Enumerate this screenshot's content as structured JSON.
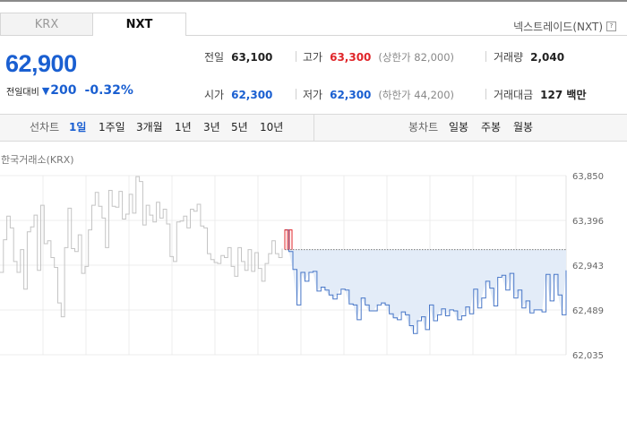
{
  "tabs": [
    {
      "label": "KRX",
      "active": false
    },
    {
      "label": "NXT",
      "active": true
    }
  ],
  "market_label": "넥스트레이드(NXT)",
  "help_icon": "?",
  "price": {
    "current": "62,900",
    "change_label": "전일대비",
    "change_direction": "down",
    "change_amount": "200",
    "change_percent": "-0.32%",
    "color": "#1a5fd1"
  },
  "summary": {
    "prev_close": {
      "label": "전일",
      "value": "63,100"
    },
    "high": {
      "label": "고가",
      "value": "63,300",
      "note": "(상한가 82,000)"
    },
    "volume": {
      "label": "거래량",
      "value": "2,040"
    },
    "open": {
      "label": "시가",
      "value": "62,300"
    },
    "low": {
      "label": "저가",
      "value": "62,300",
      "note": "(하한가 44,200)"
    },
    "trade_value": {
      "label": "거래대금",
      "value": "127 백만"
    }
  },
  "toolbar": {
    "line_label": "선차트",
    "periods": [
      "1일",
      "1주일",
      "3개월",
      "1년",
      "3년",
      "5년",
      "10년"
    ],
    "selected_period": "1일",
    "candle_label": "봉차트",
    "candle_periods": [
      "일봉",
      "주봉",
      "월봉"
    ]
  },
  "chart_data": {
    "type": "line",
    "source_label": "한국거래소(KRX)",
    "y_ticks": [
      "63,850",
      "63,396",
      "62,943",
      "62,489",
      "62,035"
    ],
    "ylim": [
      62035,
      63850
    ],
    "reference_price": 63100,
    "grid": true,
    "series": [
      {
        "color": "#c4c4c4",
        "values": [
          62870,
          63200,
          63440,
          63320,
          62980,
          62870,
          63100,
          62700,
          63280,
          63330,
          63450,
          62890,
          63550,
          63160,
          63190,
          63020,
          62920,
          62560,
          62420,
          63120,
          63520,
          63110,
          63080,
          63250,
          62860,
          62930,
          63300,
          63550,
          63680,
          63540,
          63420,
          63120,
          63700,
          63540,
          63530,
          63690,
          63410,
          63460,
          63660,
          63470,
          63840,
          63790,
          63350,
          63550,
          63450,
          63380,
          63580,
          63420,
          63510,
          63360,
          63030,
          62980,
          63380,
          63390,
          63440,
          63320,
          63510,
          63490,
          63560,
          63340,
          63320,
          63060,
          63000,
          62970,
          62960,
          63040,
          63020,
          63120,
          62930,
          62830,
          63120,
          62980,
          62890,
          63100,
          62880,
          63070,
          62910,
          62780,
          62960,
          63060,
          63190,
          63060,
          63020,
          63110
        ]
      },
      {
        "color": "#4a78c8",
        "values": [
          63300,
          63080,
          62900,
          62540,
          62870,
          62780,
          62870,
          62880,
          62680,
          62720,
          62690,
          62640,
          62600,
          62650,
          62700,
          62690,
          62550,
          62540,
          62390,
          62610,
          62540,
          62480,
          62480,
          62540,
          62560,
          62540,
          62450,
          62410,
          62390,
          62470,
          62440,
          62330,
          62250,
          62380,
          62420,
          62290,
          62540,
          62380,
          62440,
          62500,
          62430,
          62490,
          62480,
          62390,
          62430,
          62520,
          62450,
          62700,
          62510,
          62610,
          62780,
          62710,
          62530,
          62820,
          62840,
          62690,
          62860,
          62610,
          62690,
          62510,
          62580,
          62460,
          62490,
          62490,
          62470,
          62850,
          62580,
          62850,
          62640,
          62440,
          62890
        ]
      }
    ]
  }
}
